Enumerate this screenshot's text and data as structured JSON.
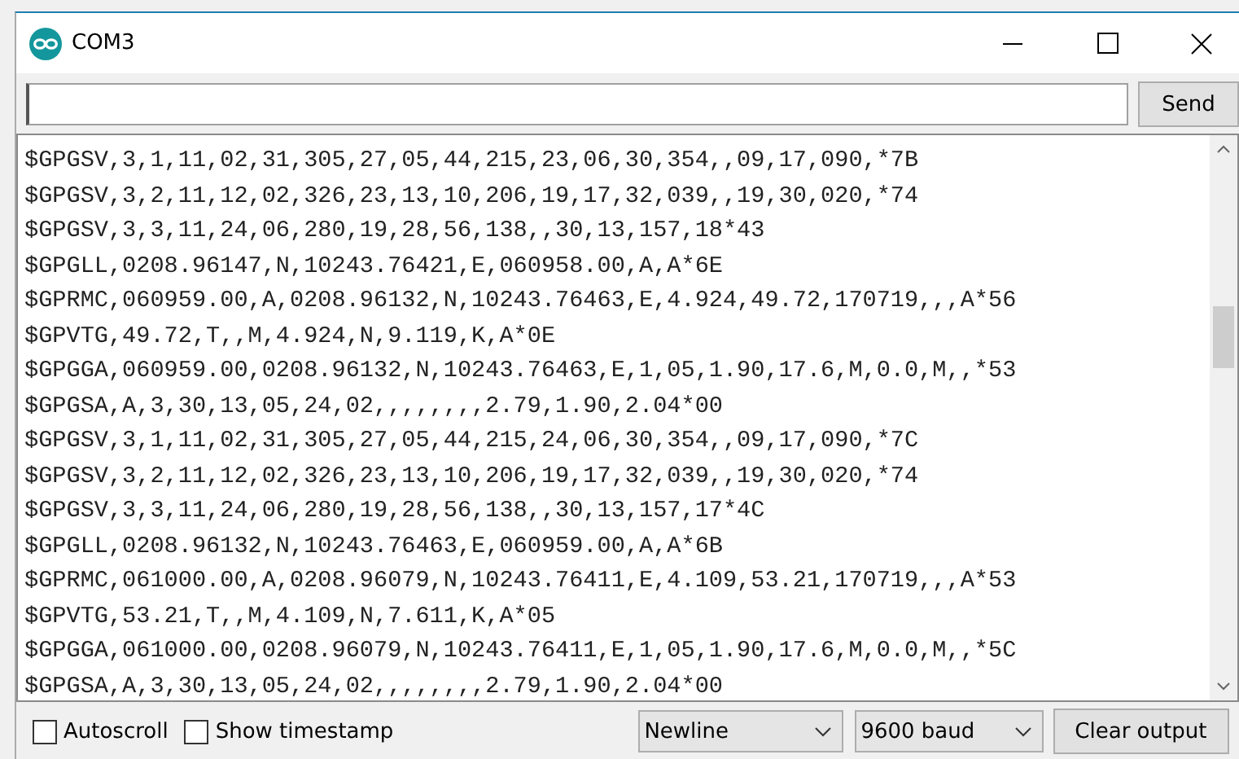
{
  "window": {
    "title": "COM3"
  },
  "send_button": "Send",
  "lines": [
    "$GPGSV,3,1,11,02,31,305,27,05,44,215,23,06,30,354,,09,17,090,*7B",
    "$GPGSV,3,2,11,12,02,326,23,13,10,206,19,17,32,039,,19,30,020,*74",
    "$GPGSV,3,3,11,24,06,280,19,28,56,138,,30,13,157,18*43",
    "$GPGLL,0208.96147,N,10243.76421,E,060958.00,A,A*6E",
    "$GPRMC,060959.00,A,0208.96132,N,10243.76463,E,4.924,49.72,170719,,,A*56",
    "$GPVTG,49.72,T,,M,4.924,N,9.119,K,A*0E",
    "$GPGGA,060959.00,0208.96132,N,10243.76463,E,1,05,1.90,17.6,M,0.0,M,,*53",
    "$GPGSA,A,3,30,13,05,24,02,,,,,,,,2.79,1.90,2.04*00",
    "$GPGSV,3,1,11,02,31,305,27,05,44,215,24,06,30,354,,09,17,090,*7C",
    "$GPGSV,3,2,11,12,02,326,23,13,10,206,19,17,32,039,,19,30,020,*74",
    "$GPGSV,3,3,11,24,06,280,19,28,56,138,,30,13,157,17*4C",
    "$GPGLL,0208.96132,N,10243.76463,E,060959.00,A,A*6B",
    "$GPRMC,061000.00,A,0208.96079,N,10243.76411,E,4.109,53.21,170719,,,A*53",
    "$GPVTG,53.21,T,,M,4.109,N,7.611,K,A*05",
    "$GPGGA,061000.00,0208.96079,N,10243.76411,E,1,05,1.90,17.6,M,0.0,M,,*5C",
    "$GPGSA,A,3,30,13,05,24,02,,,,,,,,2.79,1.90,2.04*00"
  ],
  "options": [
    {
      "label": "Autoscroll",
      "checked": false
    },
    {
      "label": "Show timestamp",
      "checked": false
    }
  ],
  "line_ending": "Newline",
  "baud_rate": "9600 baud",
  "clear_button": "Clear output"
}
